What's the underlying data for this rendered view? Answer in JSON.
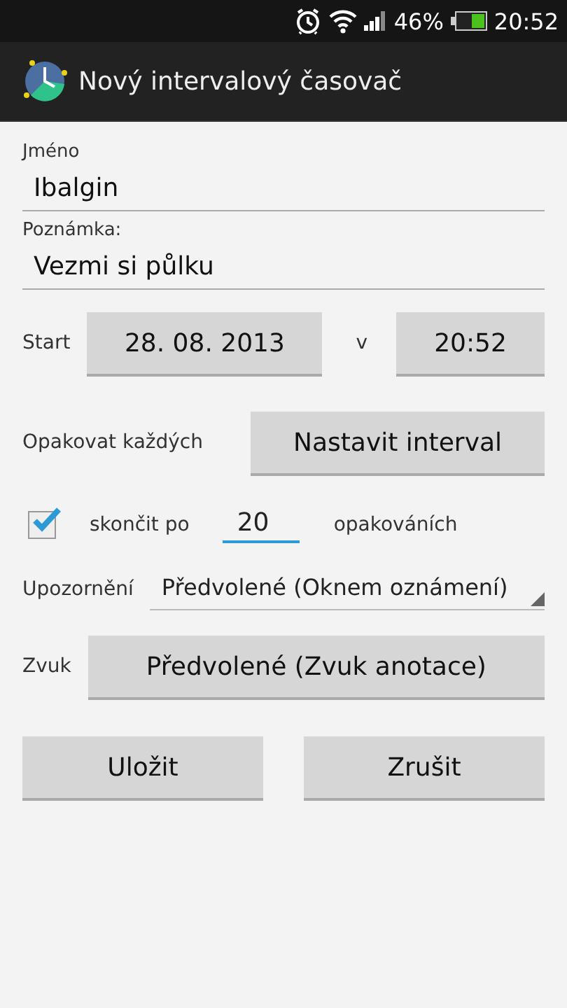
{
  "status_bar": {
    "battery_percent": "46%",
    "time": "20:52"
  },
  "action_bar": {
    "title": "Nový intervalový časovač"
  },
  "form": {
    "name_label": "Jméno",
    "name_value": "Ibalgin",
    "note_label": "Poznámka:",
    "note_value": "Vezmi si půlku",
    "start_label": "Start",
    "start_date": "28. 08. 2013",
    "at_label": "v",
    "start_time": "20:52",
    "repeat_label": "Opakovat každých",
    "repeat_button": "Nastavit interval",
    "end_checked": true,
    "end_label": "skončit po",
    "end_count": "20",
    "end_suffix": "opakováních",
    "notify_label": "Upozornění",
    "notify_value": "Předvolené (Oknem oznámení)",
    "sound_label": "Zvuk",
    "sound_button": "Předvolené (Zvuk anotace)"
  },
  "buttons": [
    "Uložit",
    "Zrušit"
  ]
}
